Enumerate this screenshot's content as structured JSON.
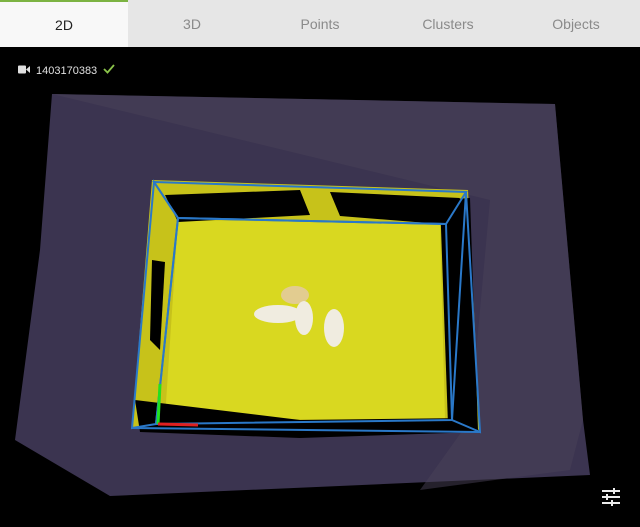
{
  "tabs": [
    {
      "label": "2D",
      "active": true
    },
    {
      "label": "3D",
      "active": false
    },
    {
      "label": "Points",
      "active": false
    },
    {
      "label": "Clusters",
      "active": false
    },
    {
      "label": "Objects",
      "active": false
    }
  ],
  "camera": {
    "id": "1403170383",
    "status_icon": "checkmark-icon",
    "icon": "video-camera-icon"
  },
  "controls": {
    "settings_icon": "sliders-icon"
  },
  "colors": {
    "tab_active_accent": "#7cb342",
    "checkmark": "#8bc34a",
    "bin_yellow": "#d9d820",
    "bbox_blue": "#2a78c8"
  }
}
